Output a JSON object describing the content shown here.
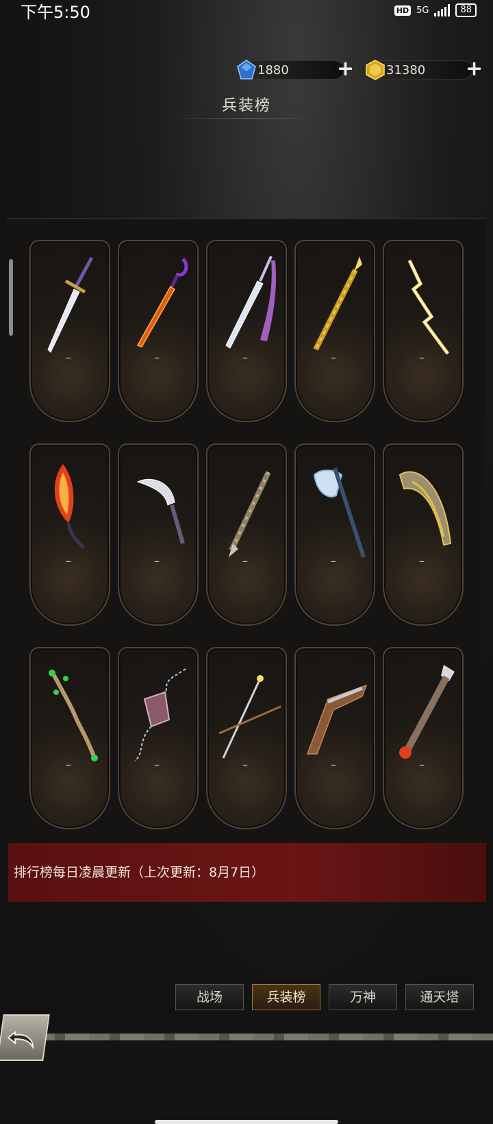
{
  "status_bar": {
    "time": "下午5:50",
    "network_badge": "HD",
    "network_type": "5G",
    "battery_level": "88"
  },
  "currency": {
    "gems": "1880",
    "gold": "31380",
    "gem_icon_color": "#3a7bd8",
    "gold_icon_color": "#e0b830"
  },
  "page_title": "兵装榜",
  "weapons": [
    {
      "icon": "broadsword-icon",
      "rank": "–"
    },
    {
      "icon": "flame-saber-icon",
      "rank": "–"
    },
    {
      "icon": "tasseled-sword-icon",
      "rank": "–"
    },
    {
      "icon": "golden-spear-icon",
      "rank": "–"
    },
    {
      "icon": "lightning-blade-icon",
      "rank": "–"
    },
    {
      "icon": "fire-scimitar-icon",
      "rank": "–"
    },
    {
      "icon": "curved-dagger-icon",
      "rank": "–"
    },
    {
      "icon": "scorpion-blade-icon",
      "rank": "–"
    },
    {
      "icon": "battle-axe-icon",
      "rank": "–"
    },
    {
      "icon": "horn-claw-icon",
      "rank": "–"
    },
    {
      "icon": "nature-staff-icon",
      "rank": "–"
    },
    {
      "icon": "chain-gauntlet-icon",
      "rank": "–"
    },
    {
      "icon": "star-wand-icon",
      "rank": "–"
    },
    {
      "icon": "flintlock-pistol-icon",
      "rank": "–"
    },
    {
      "icon": "axe-pistol-icon",
      "rank": "–"
    }
  ],
  "notice": "排行榜每日凌晨更新（上次更新：8月7日）",
  "tabs": [
    {
      "label": "战场",
      "active": false
    },
    {
      "label": "兵装榜",
      "active": true
    },
    {
      "label": "万神",
      "active": false
    },
    {
      "label": "通天塔",
      "active": false
    }
  ]
}
